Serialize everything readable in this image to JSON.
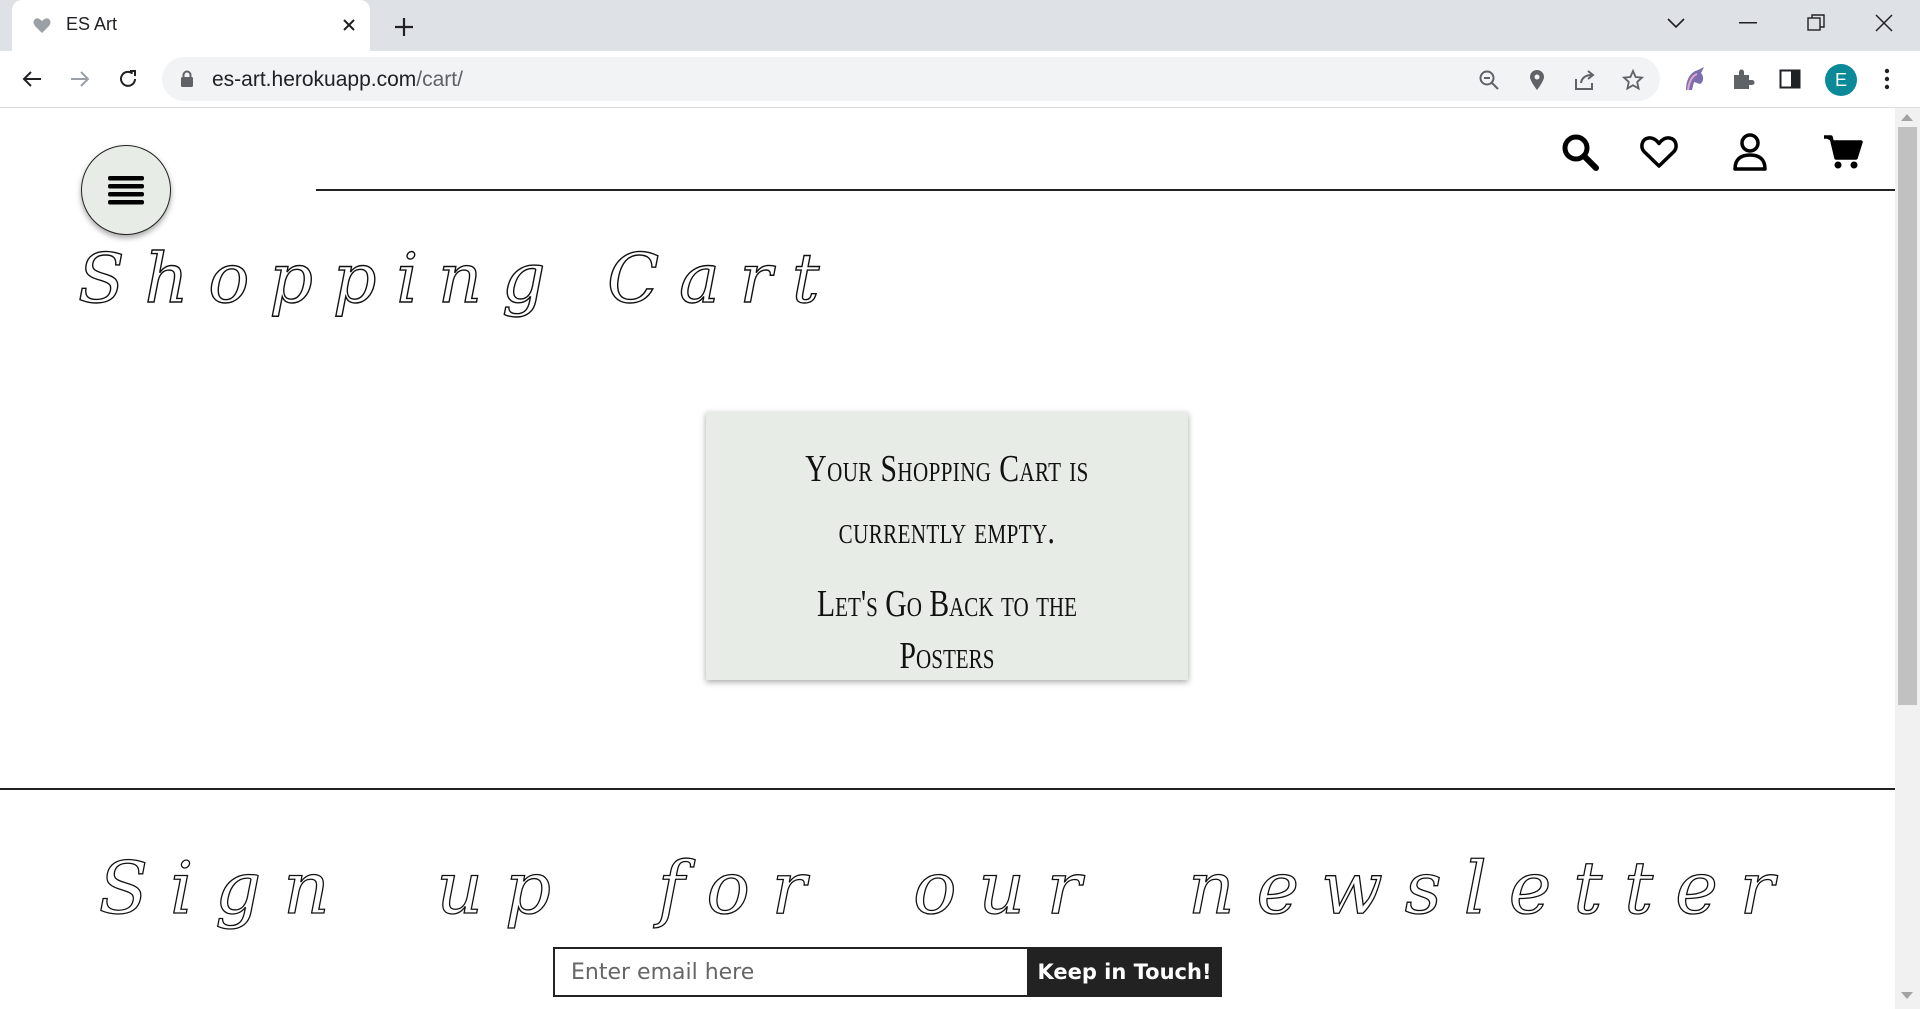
{
  "browser": {
    "tab_title": "ES Art",
    "url_host": "es-art.herokuapp.com",
    "url_path": "/cart/",
    "profile_initial": "E",
    "icons": {
      "favicon": "heart-favicon-icon",
      "close": "close-icon",
      "new_tab": "plus-icon",
      "back": "arrow-left-icon",
      "forward": "arrow-right-icon",
      "reload": "reload-icon",
      "zoom": "zoom-out-icon",
      "location": "location-pin-icon",
      "share": "share-icon",
      "bookmark": "star-icon",
      "extension_unicorn": "unicorn-icon",
      "extensions": "puzzle-icon",
      "sidepanel": "side-panel-icon",
      "menu": "kebab-menu-icon"
    }
  },
  "header": {
    "icons": [
      "hamburger-menu-icon",
      "search-icon",
      "heart-icon",
      "user-icon",
      "cart-icon"
    ]
  },
  "main": {
    "title": "Shopping Cart",
    "empty_message": "Your Shopping Cart is currently empty.",
    "back_link": "Let's Go Back to the Posters",
    "box_color": "#e8ece6"
  },
  "newsletter": {
    "title": "Sign up for our newsletter",
    "email_placeholder": "Enter email here",
    "button_label": "Keep in Touch!"
  }
}
